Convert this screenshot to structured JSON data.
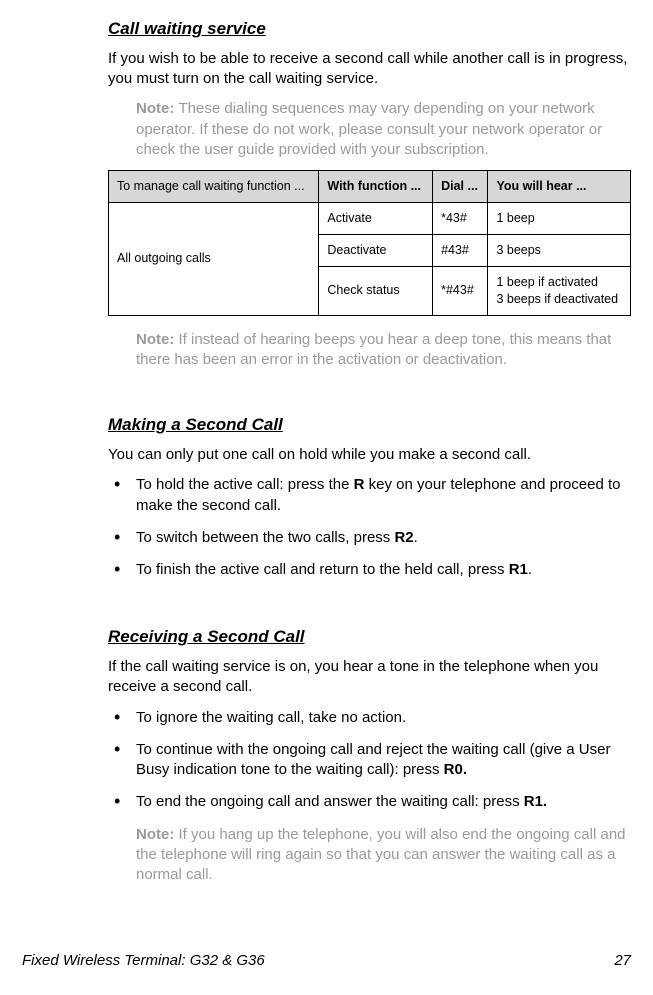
{
  "sections": {
    "callWaiting": {
      "title": "Call waiting service",
      "intro": "If you wish to be able to receive a second call while another call is in progress, you must turn on the call waiting service.",
      "note1_label": "Note: ",
      "note1_text": "These dialing sequences may vary depending on your network operator. If these do not work, please consult your network operator or check the user guide provided with your subscription.",
      "table": {
        "head": [
          "To manage call waiting function ...",
          "With function ...",
          "Dial ...",
          "You will hear ..."
        ],
        "rowgroup_label": "All outgoing calls",
        "rows": [
          {
            "func": "Activate",
            "dial": "*43#",
            "hear": "1 beep"
          },
          {
            "func": "Deactivate",
            "dial": "#43#",
            "hear": "3 beeps"
          },
          {
            "func": "Check status",
            "dial": "*#43#",
            "hear": "1 beep if activated\n3 beeps if deactivated"
          }
        ]
      },
      "note2_label": "Note: ",
      "note2_text": "If instead of hearing beeps you hear a deep tone, this means that there has been an error in the activation or deactivation."
    },
    "secondCall": {
      "title": "Making a Second Call",
      "intro": "You can only put one call on hold while you make a second call.",
      "bullets": [
        {
          "pre": "To hold the active call: press the ",
          "bold": "R",
          "post": " key on your telephone and proceed to make the second call."
        },
        {
          "pre": "To switch between the two calls, press ",
          "bold": "R2",
          "post": "."
        },
        {
          "pre": "To finish the active call and return to the held call, press ",
          "bold": "R1",
          "post": "."
        }
      ]
    },
    "receiving": {
      "title": "Receiving a Second Call",
      "intro": "If the call waiting service is on, you hear a tone in the telephone when you receive a second call.",
      "bullets": [
        {
          "pre": "To ignore the waiting call, take no action.",
          "bold": "",
          "post": ""
        },
        {
          "pre": "To continue with the ongoing call and reject the waiting call (give a User Busy indication tone to the waiting call): press ",
          "bold": "R0.",
          "post": ""
        },
        {
          "pre": "To end the ongoing call and answer the waiting call: press ",
          "bold": "R1.",
          "post": ""
        }
      ],
      "note_label": "Note: ",
      "note_text": "If you hang up the telephone, you will also end the ongoing call and the telephone will ring again so that you can answer the waiting call as a normal call."
    }
  },
  "footer": {
    "left": "Fixed Wireless Terminal: G32 & G36",
    "right": "27"
  }
}
